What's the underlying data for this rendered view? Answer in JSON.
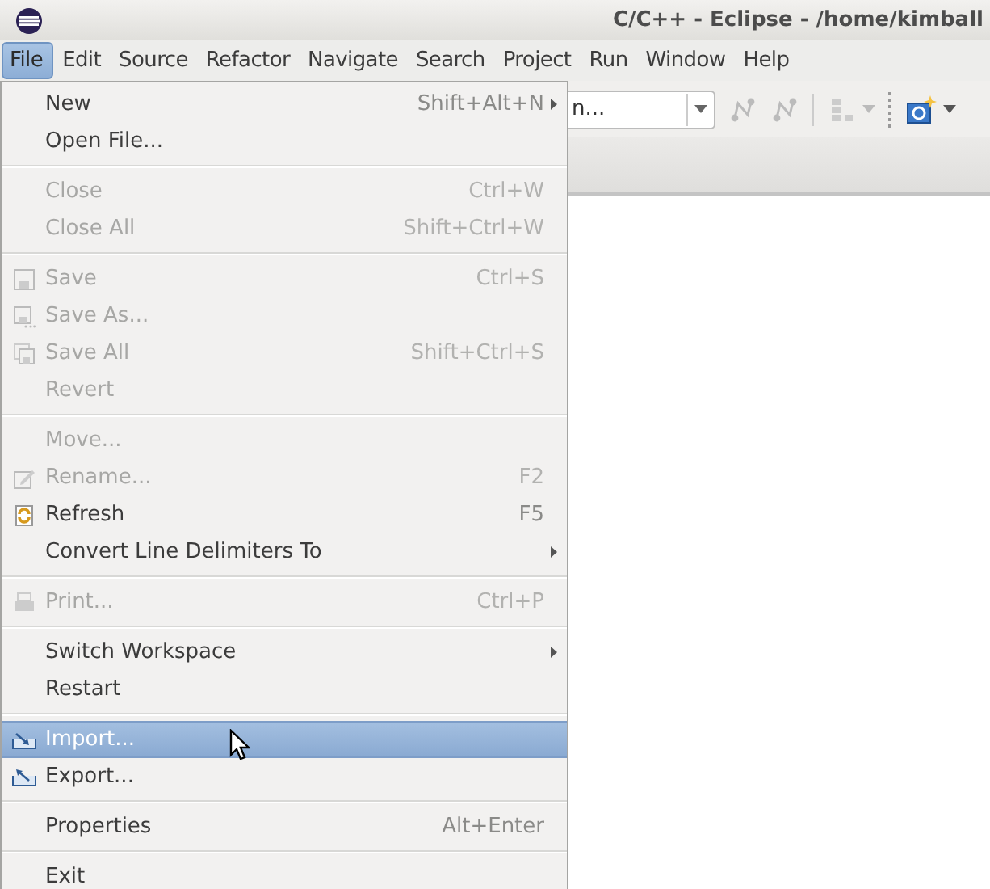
{
  "window": {
    "title": "C/C++ - Eclipse - /home/kimball"
  },
  "menubar": [
    {
      "label": "File",
      "selected": true
    },
    {
      "label": "Edit",
      "selected": false
    },
    {
      "label": "Source",
      "selected": false
    },
    {
      "label": "Refactor",
      "selected": false
    },
    {
      "label": "Navigate",
      "selected": false
    },
    {
      "label": "Search",
      "selected": false
    },
    {
      "label": "Project",
      "selected": false
    },
    {
      "label": "Run",
      "selected": false
    },
    {
      "label": "Window",
      "selected": false
    },
    {
      "label": "Help",
      "selected": false
    }
  ],
  "toolbar": {
    "combo_value": "n..."
  },
  "file_menu": [
    {
      "kind": "item",
      "label": "New",
      "shortcut": "Shift+Alt+N",
      "submenu": true,
      "disabled": false,
      "selected": false
    },
    {
      "kind": "item",
      "label": "Open File...",
      "disabled": false,
      "selected": false
    },
    {
      "kind": "separator"
    },
    {
      "kind": "item",
      "label": "Close",
      "shortcut": "Ctrl+W",
      "disabled": true,
      "selected": false
    },
    {
      "kind": "item",
      "label": "Close All",
      "shortcut": "Shift+Ctrl+W",
      "disabled": true,
      "selected": false
    },
    {
      "kind": "separator"
    },
    {
      "kind": "save",
      "label": "Save",
      "shortcut": "Ctrl+S",
      "disabled": true,
      "selected": false
    },
    {
      "kind": "save-as",
      "label": "Save As...",
      "disabled": true,
      "selected": false
    },
    {
      "kind": "save-all",
      "label": "Save All",
      "shortcut": "Shift+Ctrl+S",
      "disabled": true,
      "selected": false
    },
    {
      "kind": "item",
      "label": "Revert",
      "disabled": true,
      "selected": false
    },
    {
      "kind": "separator"
    },
    {
      "kind": "item",
      "label": "Move...",
      "disabled": true,
      "selected": false
    },
    {
      "kind": "rename",
      "label": "Rename...",
      "shortcut": "F2",
      "disabled": true,
      "selected": false
    },
    {
      "kind": "refresh",
      "label": "Refresh",
      "shortcut": "F5",
      "disabled": false,
      "selected": false
    },
    {
      "kind": "item",
      "label": "Convert Line Delimiters To",
      "submenu": true,
      "disabled": false,
      "selected": false
    },
    {
      "kind": "separator"
    },
    {
      "kind": "print",
      "label": "Print...",
      "shortcut": "Ctrl+P",
      "disabled": true,
      "selected": false
    },
    {
      "kind": "separator"
    },
    {
      "kind": "item",
      "label": "Switch Workspace",
      "submenu": true,
      "disabled": false,
      "selected": false
    },
    {
      "kind": "item",
      "label": "Restart",
      "disabled": false,
      "selected": false
    },
    {
      "kind": "separator"
    },
    {
      "kind": "import",
      "label": "Import...",
      "disabled": false,
      "selected": true
    },
    {
      "kind": "export",
      "label": "Export...",
      "disabled": false,
      "selected": false
    },
    {
      "kind": "separator"
    },
    {
      "kind": "item",
      "label": "Properties",
      "shortcut": "Alt+Enter",
      "disabled": false,
      "selected": false
    },
    {
      "kind": "separator"
    },
    {
      "kind": "item",
      "label": "Exit",
      "disabled": false,
      "selected": false
    }
  ]
}
